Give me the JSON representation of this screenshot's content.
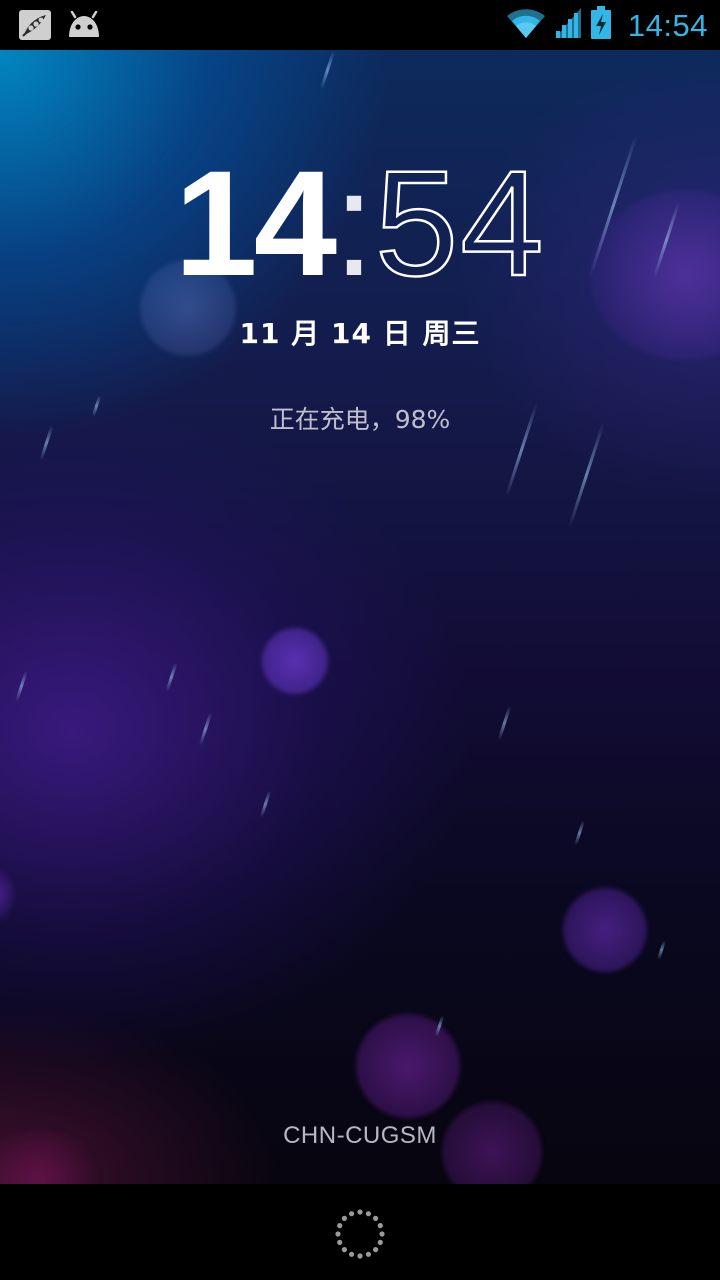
{
  "status_bar": {
    "time": "14:54",
    "left_icons": [
      "pea-pod-icon",
      "android-icon"
    ],
    "right_icons": [
      "wifi-icon",
      "cell-signal-icon",
      "battery-charging-icon"
    ],
    "accent_color": "#33b5e5"
  },
  "lock_screen": {
    "clock_hours": "14",
    "clock_separator": ":",
    "clock_minutes": "54",
    "date": "11 月 14 日 周三",
    "charging_status": "正在充电，98%",
    "carrier": "CHN-CUGSM"
  },
  "navigation": {
    "unlock_icon": "unlock-ring-icon"
  }
}
